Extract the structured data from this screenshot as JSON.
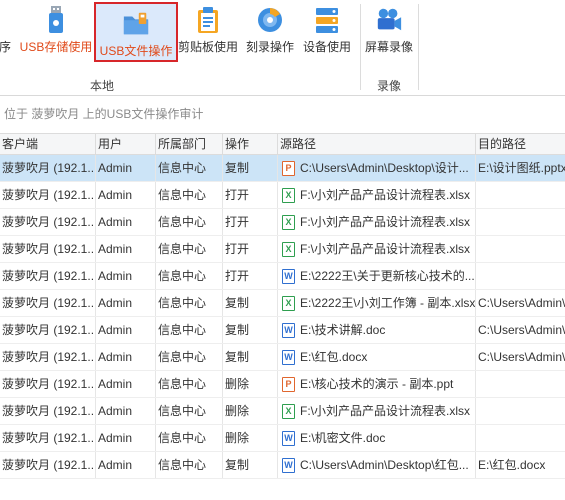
{
  "ribbon": {
    "buttons": [
      {
        "label": "序",
        "icon": "usb-partial-icon"
      },
      {
        "label": "USB存储使用",
        "icon": "usb-storage-icon"
      },
      {
        "label": "USB文件操作",
        "icon": "usb-folder-icon"
      },
      {
        "label": "剪贴板使用",
        "icon": "clipboard-icon"
      },
      {
        "label": "刻录操作",
        "icon": "disc-icon"
      },
      {
        "label": "设备使用",
        "icon": "device-icon"
      },
      {
        "label": "屏幕录像",
        "icon": "video-camera-icon"
      }
    ],
    "groups": [
      "本地",
      "录像"
    ]
  },
  "breadcrumb": "位于 菠萝吹月 上的USB文件操作审计",
  "table": {
    "columns": [
      "客户端",
      "用户",
      "所属部门",
      "操作",
      "源路径",
      "目的路径"
    ],
    "rows": [
      {
        "client": "菠萝吹月 (192.1...",
        "user": "Admin",
        "dept": "信息中心",
        "op": "复制",
        "src": "C:\\Users\\Admin\\Desktop\\设计...",
        "dst": "E:\\设计图纸.pptx",
        "ftype": "ppt"
      },
      {
        "client": "菠萝吹月 (192.1...",
        "user": "Admin",
        "dept": "信息中心",
        "op": "打开",
        "src": "F:\\小刘产品产品设计流程表.xlsx",
        "dst": "",
        "ftype": "xls"
      },
      {
        "client": "菠萝吹月 (192.1...",
        "user": "Admin",
        "dept": "信息中心",
        "op": "打开",
        "src": "F:\\小刘产品产品设计流程表.xlsx",
        "dst": "",
        "ftype": "xls"
      },
      {
        "client": "菠萝吹月 (192.1...",
        "user": "Admin",
        "dept": "信息中心",
        "op": "打开",
        "src": "F:\\小刘产品产品设计流程表.xlsx",
        "dst": "",
        "ftype": "xls"
      },
      {
        "client": "菠萝吹月 (192.1...",
        "user": "Admin",
        "dept": "信息中心",
        "op": "打开",
        "src": "E:\\2222王\\关于更新核心技术的...",
        "dst": "",
        "ftype": "doc"
      },
      {
        "client": "菠萝吹月 (192.1...",
        "user": "Admin",
        "dept": "信息中心",
        "op": "复制",
        "src": "E:\\2222王\\小刘工作簿 - 副本.xlsx",
        "dst": "C:\\Users\\Admin\\",
        "ftype": "xls"
      },
      {
        "client": "菠萝吹月 (192.1...",
        "user": "Admin",
        "dept": "信息中心",
        "op": "复制",
        "src": "E:\\技术讲解.doc",
        "dst": "C:\\Users\\Admin\\",
        "ftype": "doc"
      },
      {
        "client": "菠萝吹月 (192.1...",
        "user": "Admin",
        "dept": "信息中心",
        "op": "复制",
        "src": "E:\\红包.docx",
        "dst": "C:\\Users\\Admin\\",
        "ftype": "doc"
      },
      {
        "client": "菠萝吹月 (192.1...",
        "user": "Admin",
        "dept": "信息中心",
        "op": "删除",
        "src": "E:\\核心技术的演示 - 副本.ppt",
        "dst": "",
        "ftype": "ppt"
      },
      {
        "client": "菠萝吹月 (192.1...",
        "user": "Admin",
        "dept": "信息中心",
        "op": "删除",
        "src": "F:\\小刘产品产品设计流程表.xlsx",
        "dst": "",
        "ftype": "xls"
      },
      {
        "client": "菠萝吹月 (192.1...",
        "user": "Admin",
        "dept": "信息中心",
        "op": "删除",
        "src": "E:\\机密文件.doc",
        "dst": "",
        "ftype": "doc"
      },
      {
        "client": "菠萝吹月 (192.1...",
        "user": "Admin",
        "dept": "信息中心",
        "op": "复制",
        "src": "C:\\Users\\Admin\\Desktop\\红包...",
        "dst": "E:\\红包.docx",
        "ftype": "doc"
      }
    ]
  },
  "colors": {
    "accent": "#e04a1a",
    "selection": "#cce4f7",
    "highlight_border": "#d7262a"
  }
}
